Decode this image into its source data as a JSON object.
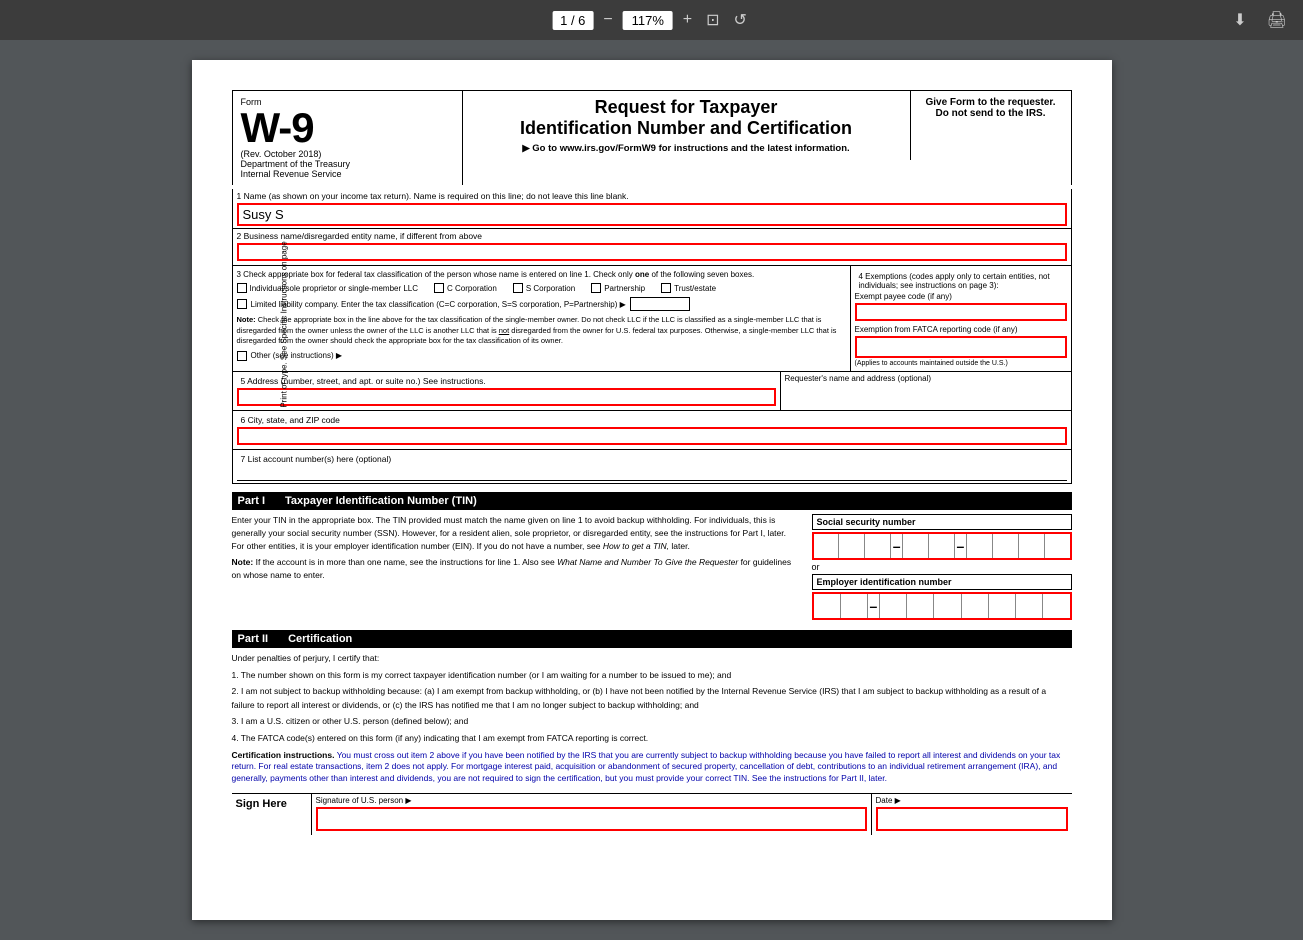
{
  "toolbar": {
    "page_current": "1",
    "page_total": "6",
    "zoom": "117%",
    "minus_label": "−",
    "plus_label": "+",
    "download_icon": "⬇",
    "print_icon": "🖨"
  },
  "form": {
    "form_label": "Form",
    "form_name": "W-9",
    "rev_date": "(Rev. October 2018)",
    "dept": "Department of the Treasury",
    "irs": "Internal Revenue Service",
    "title_line1": "Request for Taxpayer",
    "title_line2": "Identification Number and Certification",
    "instructions_link": "▶ Go to www.irs.gov/FormW9 for instructions and the latest information.",
    "give_form": "Give Form to the requester. Do not send to the IRS.",
    "line1_label": "1  Name (as shown on your income tax return). Name is required on this line; do not leave this line blank.",
    "line1_value": "Susy S",
    "line2_label": "2  Business name/disregarded entity name, if different from above",
    "line2_value": "",
    "line3_label": "3  Check appropriate box for federal tax classification of the person whose name is entered on line 1. Check only",
    "line3_label2": "one",
    "line3_label3": "of the following seven boxes.",
    "check_only_note": "Check only",
    "do_not_check_note": "Do not check",
    "individual_label": "Individual/sole proprietor or single-member LLC",
    "c_corp_label": "C Corporation",
    "s_corp_label": "S Corporation",
    "partnership_label": "Partnership",
    "trust_label": "Trust/estate",
    "llc_label": "Limited liability company. Enter the tax classification (C=C corporation, S=S corporation, P=Partnership) ▶",
    "llc_input": "",
    "note_label": "Note:",
    "note_text": "Check the appropriate box in the line above for the tax classification of the single-member owner.  Do not check LLC if the LLC is classified as a single-member LLC that is disregarded from the owner unless the owner of the LLC is another LLC that is",
    "not_text": "not",
    "note_text2": "disregarded from the owner for U.S. federal tax purposes. Otherwise, a single-member LLC that is disregarded from the owner should check the appropriate box for the tax classification of its owner.",
    "other_label": "Other (see instructions) ▶",
    "line4_label": "4  Exemptions (codes apply only to certain entities, not individuals; see instructions on page 3):",
    "exempt_payee_label": "Exempt payee code (if any)",
    "exempt_payee_value": "",
    "fatca_label": "Exemption from FATCA reporting code (if any)",
    "fatca_value": "",
    "fatca_note": "(Applies to accounts maintained outside the U.S.)",
    "line5_label": "5  Address (number, street, and apt. or suite no.) See instructions.",
    "line5_value": "",
    "requester_label": "Requester's name and address (optional)",
    "line6_label": "6  City, state, and ZIP code",
    "line6_value": "",
    "line7_label": "7  List account number(s) here (optional)",
    "line7_value": "",
    "part1_label": "Part I",
    "part1_title": "Taxpayer Identification Number (TIN)",
    "part1_text": "Enter your TIN in the appropriate box. The TIN provided must match the name given on line 1 to avoid backup withholding. For individuals, this is generally your social security number (SSN). However, for a resident alien, sole proprietor, or disregarded entity, see the instructions for Part I, later. For other entities, it is your employer identification number (EIN). If you do not have a number, see",
    "how_to_get": "How to get a TIN,",
    "part1_text2": "later.",
    "part1_note_label": "Note:",
    "part1_note": "If the account is in more than one name, see the instructions for line 1. Also see",
    "what_name": "What Name and Number To Give the Requester",
    "part1_note2": "for guidelines on whose name to enter.",
    "ssn_label": "Social security number",
    "ssn_value": "",
    "or_text": "or",
    "ein_label": "Employer identification number",
    "ein_value": "",
    "part2_label": "Part II",
    "part2_title": "Certification",
    "under_penalties": "Under penalties of perjury, I certify that:",
    "cert1": "1. The number shown on this form is my correct taxpayer identification number (or I am waiting for a number to be issued to me); and",
    "cert2": "2. I am not subject to backup withholding because: (a) I am exempt from backup withholding, or (b) I have not been notified by the Internal Revenue Service (IRS) that I am subject to backup withholding as a result of a failure to report all interest or dividends, or (c) the IRS has notified me that I am no longer subject to backup withholding; and",
    "cert3": "3. I am a U.S. citizen or other U.S. person (defined below); and",
    "cert4": "4. The FATCA code(s) entered on this form (if any) indicating that I am exempt from FATCA reporting is correct.",
    "cert_instr_label": "Certification instructions.",
    "cert_instr_text": "You must cross out item 2 above if you have been notified by the IRS that you are currently subject to backup withholding because you have failed to report all interest and dividends on your tax return. For real estate transactions, item 2 does not apply. For mortgage interest paid, acquisition or abandonment of secured property, cancellation of debt, contributions to an individual retirement arrangement (IRA), and generally, payments other than interest and dividends, you are not required to sign the certification, but you must provide your correct TIN. See the instructions for Part II, later.",
    "sign_here_label": "Sign Here",
    "signature_label": "Signature of U.S. person ▶",
    "signature_value": "",
    "date_label": "Date ▶",
    "date_value": "",
    "sidebar_text": "Print or type. See Specific Instructions on page"
  }
}
